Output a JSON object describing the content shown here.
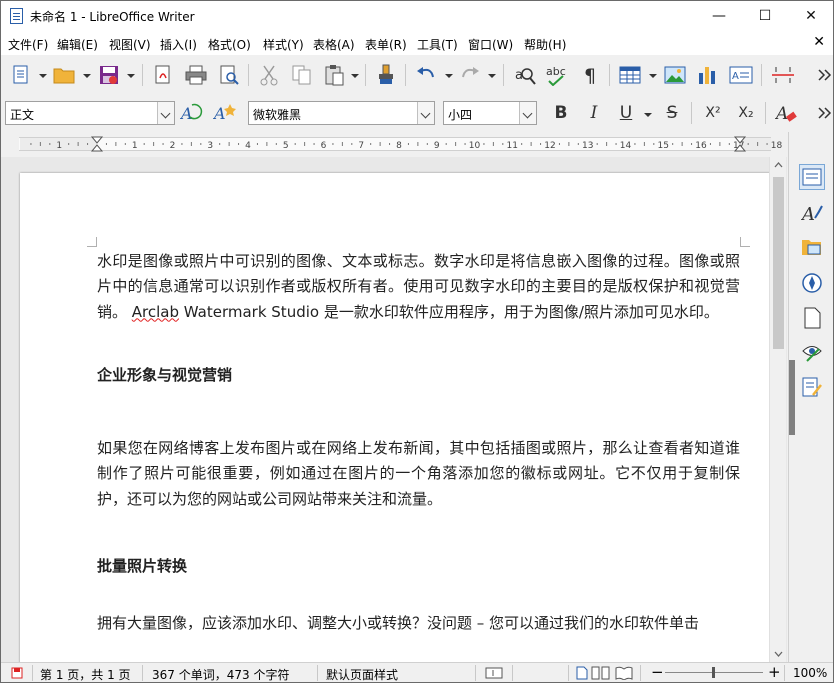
{
  "window": {
    "title": "未命名 1 - LibreOffice Writer",
    "minimize": "—",
    "maximize": "☐",
    "close": "✕"
  },
  "menu": {
    "items": [
      "文件(F)",
      "编辑(E)",
      "视图(V)",
      "插入(I)",
      "格式(O)",
      "样式(Y)",
      "表格(A)",
      "表单(R)",
      "工具(T)",
      "窗口(W)",
      "帮助(H)"
    ],
    "close_doc": "✕"
  },
  "formatting": {
    "paragraph_style": "正文",
    "font_name": "微软雅黑",
    "font_size": "小四",
    "bold": "B",
    "italic": "I",
    "underline": "U",
    "strike": "S",
    "superscript": "X²",
    "subscript": "X₂"
  },
  "ruler": {
    "labels": [
      "1",
      "1",
      "2",
      "3",
      "4",
      "5",
      "6",
      "7",
      "8",
      "9",
      "10",
      "11",
      "12",
      "13",
      "14",
      "15",
      "16",
      "17",
      "18"
    ]
  },
  "document": {
    "p1_before": "水印是图像或照片中可识别的图像、文本或标志。数字水印是将信息嵌入图像的过程。图像或照片中的信息通常可以识别作者或版权所有者。使用可见数字水印的主要目的是版权保护和视觉营销。 ",
    "p1_spell": "Arclab",
    "p1_after": " Watermark Studio 是一款水印软件应用程序，用于为图像/照片添加可见水印。",
    "h1": "企业形象与视觉营销",
    "p2": "如果您在网络博客上发布图片或在网络上发布新闻，其中包括插图或照片，那么让查看者知道谁制作了照片可能很重要，例如通过在图片的一个角落添加您的徽标或网址。它不仅用于复制保护，还可以为您的网站或公司网站带来关注和流量。",
    "h2": "批量照片转换",
    "p3": "拥有大量图像，应该添加水印、调整大小或转换？没问题 – 您可以通过我们的水印软件单击"
  },
  "status": {
    "page": "第 1 页，共 1 页",
    "words": "367 个单词，473 个字符",
    "page_style": "默认页面样式",
    "zoom": "100%",
    "zoom_minus": "−",
    "zoom_plus": "+"
  },
  "colors": {
    "accent_blue": "#2a5ea8",
    "spell_red": "#e02020",
    "save_purple": "#7a2a8c"
  }
}
